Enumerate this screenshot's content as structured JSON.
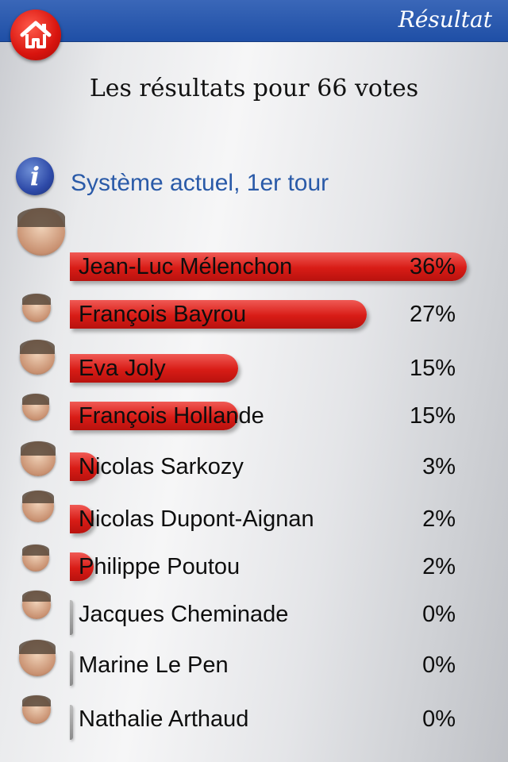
{
  "header": {
    "title": "Résultat",
    "home_icon": "home-icon"
  },
  "headline": "Les résultats pour 66 votes",
  "section": {
    "title": "Système actuel, 1er tour",
    "icon": "info-icon",
    "info_glyph": "i"
  },
  "colors": {
    "topbar": "#2a5bb0",
    "bar": "#d81c16",
    "section_title": "#2a5aa8",
    "home_button": "#d8140e"
  },
  "candidates": [
    {
      "name": "Jean-Luc Mélenchon",
      "percent_label": "36%",
      "value": 36
    },
    {
      "name": "François Bayrou",
      "percent_label": "27%",
      "value": 27
    },
    {
      "name": "Eva Joly",
      "percent_label": "15%",
      "value": 15
    },
    {
      "name": "François Hollande",
      "percent_label": "15%",
      "value": 15
    },
    {
      "name": "Nicolas Sarkozy",
      "percent_label": "3%",
      "value": 3
    },
    {
      "name": "Nicolas Dupont-Aignan",
      "percent_label": "2%",
      "value": 2
    },
    {
      "name": "Philippe Poutou",
      "percent_label": "2%",
      "value": 2
    },
    {
      "name": "Jacques Cheminade",
      "percent_label": "0%",
      "value": 0
    },
    {
      "name": "Marine Le Pen",
      "percent_label": "0%",
      "value": 0
    },
    {
      "name": "Nathalie Arthaud",
      "percent_label": "0%",
      "value": 0
    }
  ]
}
